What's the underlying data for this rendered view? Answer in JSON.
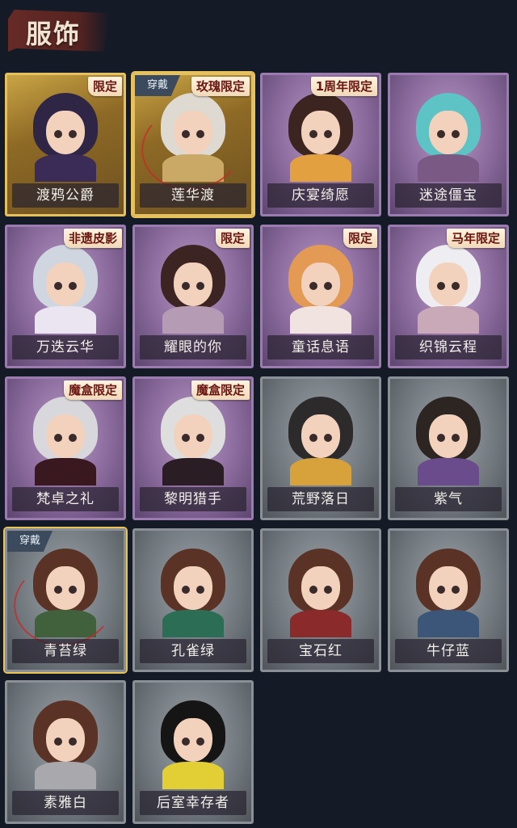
{
  "header": {
    "title": "服饰"
  },
  "items": [
    {
      "name": "渡鸦公爵",
      "tag": "限定",
      "badge": "",
      "style": "gold",
      "hair": "#2f2545",
      "outfit": "#3b2c57"
    },
    {
      "name": "莲华渡",
      "tag": "玫瑰限定",
      "badge": "穿戴",
      "style": "gold",
      "hair": "#dedad2",
      "outfit": "#caa866"
    },
    {
      "name": "庆宴绮愿",
      "tag": "1周年限定",
      "badge": "",
      "style": "purple",
      "hair": "#3c2521",
      "outfit": "#e3a040"
    },
    {
      "name": "迷途僵宝",
      "tag": "",
      "badge": "",
      "style": "purple",
      "hair": "#5ec3c4",
      "outfit": "#7a5a85"
    },
    {
      "name": "万迭云华",
      "tag": "非遗皮影",
      "badge": "",
      "style": "purple",
      "hair": "#cfd6df",
      "outfit": "#ebe4f1"
    },
    {
      "name": "耀眼的你",
      "tag": "限定",
      "badge": "",
      "style": "purple",
      "hair": "#3b2422",
      "outfit": "#b59bb4"
    },
    {
      "name": "童话息语",
      "tag": "限定",
      "badge": "",
      "style": "purple",
      "hair": "#e39a54",
      "outfit": "#f1e3df"
    },
    {
      "name": "织锦云程",
      "tag": "马年限定",
      "badge": "",
      "style": "purple",
      "hair": "#eeeef2",
      "outfit": "#c9a9b8"
    },
    {
      "name": "梵卓之礼",
      "tag": "魔盒限定",
      "badge": "",
      "style": "purple",
      "hair": "#d8d8dc",
      "outfit": "#3a1820"
    },
    {
      "name": "黎明猎手",
      "tag": "魔盒限定",
      "badge": "",
      "style": "purple",
      "hair": "#dedede",
      "outfit": "#2a1d24"
    },
    {
      "name": "荒野落日",
      "tag": "",
      "badge": "",
      "style": "gray",
      "hair": "#2c2a2a",
      "outfit": "#d7a23c"
    },
    {
      "name": "紫气",
      "tag": "",
      "badge": "",
      "style": "gray",
      "hair": "#2d2522",
      "outfit": "#6a4b8c"
    },
    {
      "name": "青苔绿",
      "tag": "",
      "badge": "穿戴",
      "style": "gray",
      "hair": "#5b3326",
      "outfit": "#40613c"
    },
    {
      "name": "孔雀绿",
      "tag": "",
      "badge": "",
      "style": "gray",
      "hair": "#5b3326",
      "outfit": "#2c6d56"
    },
    {
      "name": "宝石红",
      "tag": "",
      "badge": "",
      "style": "gray",
      "hair": "#5b3326",
      "outfit": "#8a2a2a"
    },
    {
      "name": "牛仔蓝",
      "tag": "",
      "badge": "",
      "style": "gray",
      "hair": "#5b3326",
      "outfit": "#3c567a"
    },
    {
      "name": "素雅白",
      "tag": "",
      "badge": "",
      "style": "gray",
      "hair": "#5b3326",
      "outfit": "#a9a9ad"
    },
    {
      "name": "后室幸存者",
      "tag": "",
      "badge": "",
      "style": "gray",
      "hair": "#151515",
      "outfit": "#e2cf35"
    }
  ]
}
